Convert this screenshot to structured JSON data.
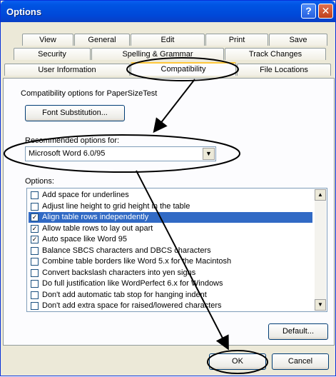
{
  "window": {
    "title": "Options"
  },
  "title_buttons": {
    "help": "?",
    "close": "✕"
  },
  "tabs": {
    "row1": [
      "View",
      "General",
      "Edit",
      "Print",
      "Save"
    ],
    "row2": [
      "Security",
      "Spelling & Grammar",
      "Track Changes"
    ],
    "row3": [
      "User Information",
      "Compatibility",
      "File Locations"
    ],
    "active": "Compatibility"
  },
  "panel": {
    "compat_label": "Compatibility options for PaperSizeTest",
    "font_substitution_button": "Font Substitution...",
    "recommended_label": "Recommended options for:",
    "recommended_value": "Microsoft Word 6.0/95",
    "options_label": "Options:",
    "options": [
      {
        "label": "Add space for underlines",
        "checked": false
      },
      {
        "label": "Adjust line height to grid height in the table",
        "checked": false
      },
      {
        "label": "Align table rows independently",
        "checked": true,
        "selected": true
      },
      {
        "label": "Allow table rows to lay out apart",
        "checked": true
      },
      {
        "label": "Auto space like Word 95",
        "checked": true
      },
      {
        "label": "Balance SBCS characters and DBCS characters",
        "checked": false
      },
      {
        "label": "Combine table borders like Word 5.x for the Macintosh",
        "checked": false
      },
      {
        "label": "Convert backslash characters into yen signs",
        "checked": false
      },
      {
        "label": "Do full justification like WordPerfect 6.x for Windows",
        "checked": false
      },
      {
        "label": "Don't add automatic tab stop for hanging indent",
        "checked": false
      },
      {
        "label": "Don't add extra space for raised/lowered characters",
        "checked": false
      }
    ],
    "default_button": "Default..."
  },
  "footer": {
    "ok_button": "OK",
    "cancel_button": "Cancel"
  },
  "colors": {
    "titlebar": "#0054e3",
    "selection": "#316ac5",
    "dialog_bg": "#ece9d8"
  }
}
